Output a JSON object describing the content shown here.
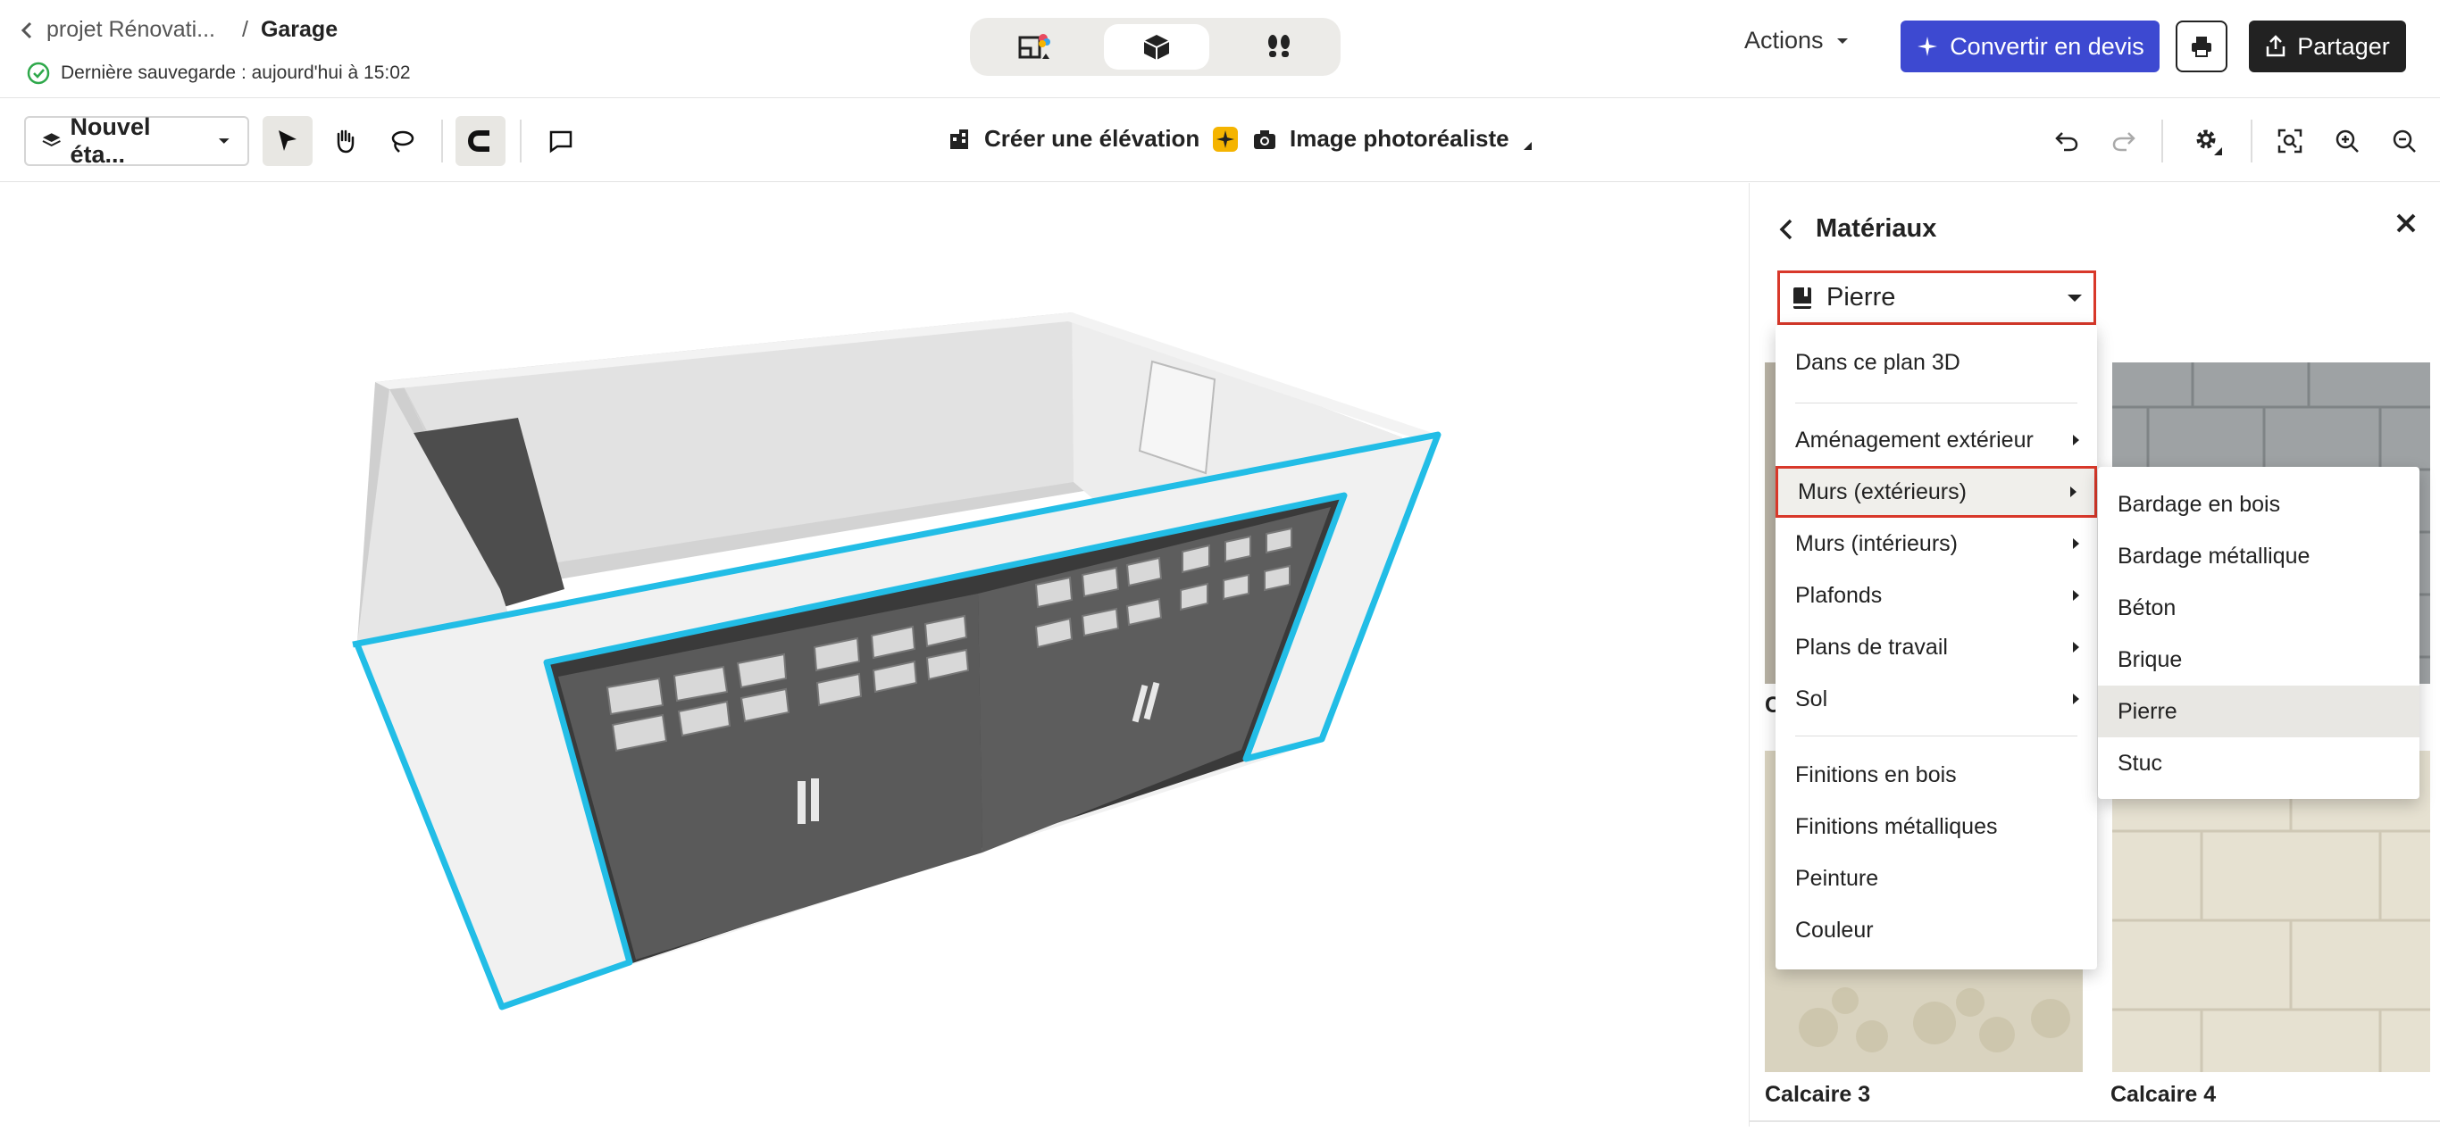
{
  "header": {
    "back_label": "projet Rénovati...",
    "separator": "/",
    "current": "Garage",
    "save_status": "Dernière sauvegarde : aujourd'hui à 15:02",
    "modes": [
      "plan-2d-icon",
      "view-3d-icon",
      "walkthrough-icon"
    ],
    "actions_label": "Actions",
    "convert_label": "Convertir en devis",
    "share_label": "Partager"
  },
  "toolbar": {
    "level_label": "Nouvel éta...",
    "elevation_label": "Créer une élévation",
    "photo_label": "Image photoréaliste"
  },
  "panel": {
    "title": "Matériaux",
    "category_selected": "Pierre",
    "swatches": [
      {
        "label": "C"
      },
      {
        "label": ""
      },
      {
        "label": "C"
      },
      {
        "label": ""
      },
      {
        "label": "Calcaire 3"
      },
      {
        "label": "Calcaire 4"
      }
    ]
  },
  "dropdown": {
    "items": [
      {
        "label": "Dans ce plan 3D",
        "submenu": false
      },
      {
        "label": "Aménagement extérieur",
        "submenu": true
      },
      {
        "label": "Murs (extérieurs)",
        "submenu": true,
        "highlighted": true
      },
      {
        "label": "Murs (intérieurs)",
        "submenu": true
      },
      {
        "label": "Plafonds",
        "submenu": true
      },
      {
        "label": "Plans de travail",
        "submenu": true
      },
      {
        "label": "Sol",
        "submenu": true
      },
      {
        "label": "Finitions en bois",
        "submenu": false
      },
      {
        "label": "Finitions métalliques",
        "submenu": false
      },
      {
        "label": "Peinture",
        "submenu": false
      },
      {
        "label": "Couleur",
        "submenu": false
      }
    ]
  },
  "submenu": {
    "items": [
      {
        "label": "Bardage en bois"
      },
      {
        "label": "Bardage métallique"
      },
      {
        "label": "Béton"
      },
      {
        "label": "Brique"
      },
      {
        "label": "Pierre",
        "selected": true
      },
      {
        "label": "Stuc"
      }
    ]
  },
  "colors": {
    "accent_blue": "#3d49d1",
    "highlight_red": "#d8382a",
    "selection_cyan": "#22bde6",
    "save_ok_green": "#2ea84a",
    "star_yellow": "#f5b400"
  }
}
